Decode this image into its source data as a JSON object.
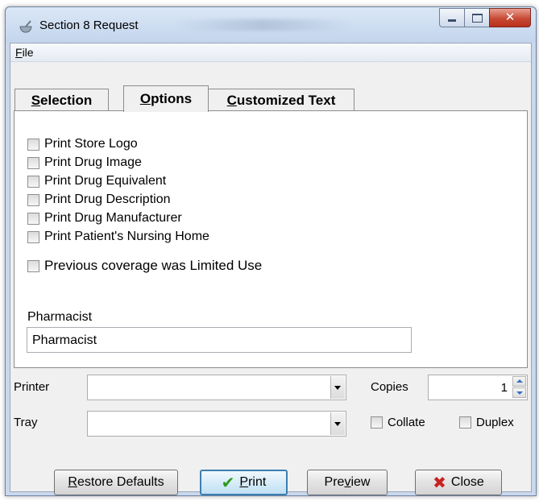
{
  "window": {
    "title": "Section 8 Request"
  },
  "menu": {
    "file": "File"
  },
  "tabs": [
    {
      "pre": "",
      "accel": "S",
      "post": "election"
    },
    {
      "pre": "",
      "accel": "O",
      "post": "ptions"
    },
    {
      "pre": "",
      "accel": "C",
      "post": "ustomized Text"
    }
  ],
  "options": {
    "checkboxes": [
      {
        "label": "Print Store Logo",
        "checked": false
      },
      {
        "label": "Print Drug Image",
        "checked": false
      },
      {
        "label": "Print Drug Equivalent",
        "checked": false
      },
      {
        "label": "Print Drug Description",
        "checked": false
      },
      {
        "label": "Print Drug Manufacturer",
        "checked": false
      },
      {
        "label": "Print Patient's Nursing Home",
        "checked": false
      },
      {
        "label": "Previous coverage was Limited Use",
        "checked": false
      }
    ],
    "pharmacist_label": "Pharmacist",
    "pharmacist_value": "Pharmacist"
  },
  "print_settings": {
    "printer_label": "Printer",
    "printer_value": "",
    "tray_label": "Tray",
    "tray_value": "",
    "copies_label": "Copies",
    "copies_value": "1",
    "collate_label": "Collate",
    "collate_checked": false,
    "duplex_label": "Duplex",
    "duplex_checked": false
  },
  "buttons": {
    "restore": {
      "accel": "R",
      "rest": "estore Defaults"
    },
    "print": {
      "accel": "P",
      "rest": "rint"
    },
    "preview": {
      "pre": "Pre",
      "accel": "v",
      "rest": "iew"
    },
    "close": {
      "label": "Close"
    }
  }
}
